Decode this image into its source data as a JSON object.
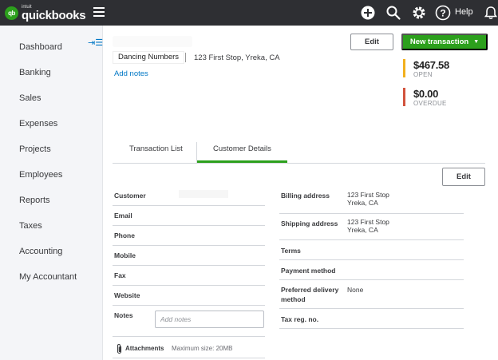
{
  "app": {
    "brand_small": "intuit",
    "brand": "quickbooks",
    "badge": "qb"
  },
  "topbar": {
    "help_label": "Help"
  },
  "sidebar": {
    "items": [
      {
        "label": "Dashboard"
      },
      {
        "label": "Banking"
      },
      {
        "label": "Sales"
      },
      {
        "label": "Expenses"
      },
      {
        "label": "Projects"
      },
      {
        "label": "Employees"
      },
      {
        "label": "Reports"
      },
      {
        "label": "Taxes"
      },
      {
        "label": "Accounting"
      },
      {
        "label": "My Accountant"
      }
    ]
  },
  "customer": {
    "company": "Dancing Numbers",
    "address": "123 First Stop, Yreka, CA",
    "add_notes": "Add notes"
  },
  "actions": {
    "edit": "Edit",
    "new_transaction": "New transaction"
  },
  "balances": {
    "open": {
      "amount": "$467.58",
      "label": "OPEN",
      "color": "#f2b01e"
    },
    "overdue": {
      "amount": "$0.00",
      "label": "OVERDUE",
      "color": "#d2533d"
    }
  },
  "tabs": [
    {
      "label": "Transaction List",
      "active": false
    },
    {
      "label": "Customer Details",
      "active": true
    }
  ],
  "details": {
    "edit": "Edit",
    "left_fields": [
      {
        "label": "Customer"
      },
      {
        "label": "Email"
      },
      {
        "label": "Phone"
      },
      {
        "label": "Mobile"
      },
      {
        "label": "Fax"
      },
      {
        "label": "Website"
      },
      {
        "label": "Notes"
      }
    ],
    "notes_placeholder": "Add notes",
    "right_fields": {
      "billing": {
        "label": "Billing address",
        "line1": "123 First Stop",
        "line2": "Yreka, CA"
      },
      "shipping": {
        "label": "Shipping address",
        "line1": "123 First Stop",
        "line2": "Yreka, CA"
      },
      "terms": {
        "label": "Terms"
      },
      "payment": {
        "label": "Payment method"
      },
      "delivery": {
        "label_line1": "Preferred delivery",
        "label_line2": "method",
        "value": "None"
      },
      "tax": {
        "label": "Tax reg. no."
      }
    },
    "attachments": {
      "label": "Attachments",
      "max_size": "Maximum size: 20MB"
    }
  },
  "colors": {
    "brand_green": "#2ca01c",
    "link_blue": "#0077c5",
    "topbar": "#2e2f33"
  }
}
